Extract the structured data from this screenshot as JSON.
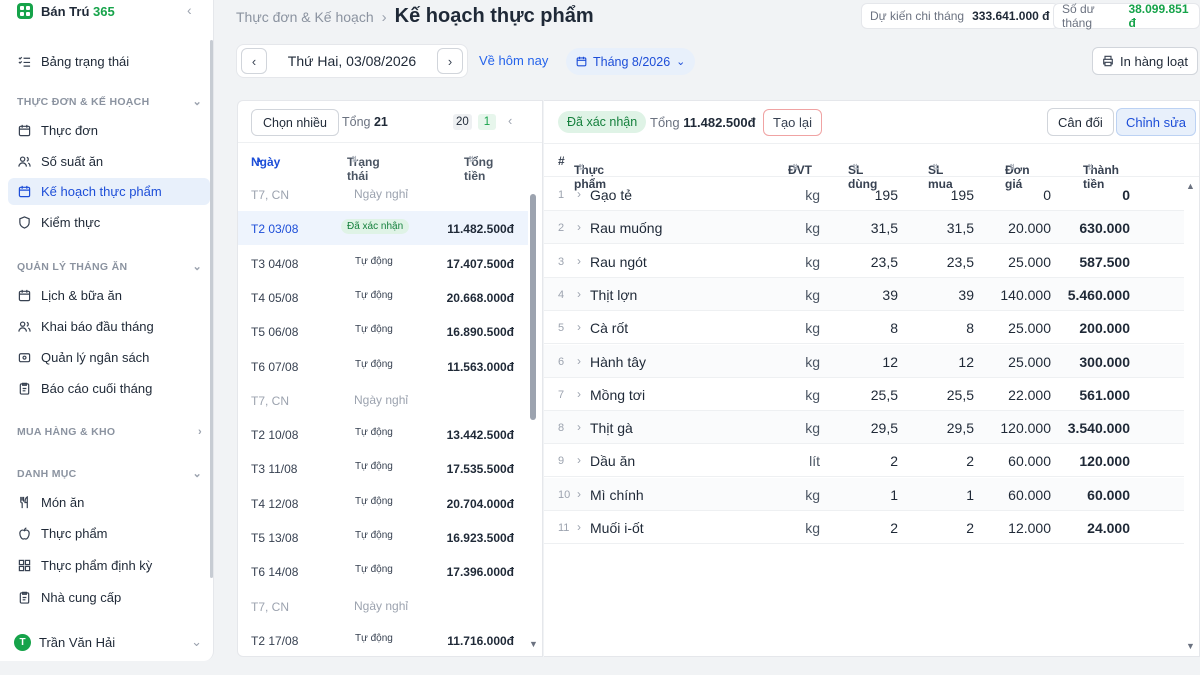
{
  "app": {
    "name_main": "Bán Trú",
    "name_accent": "365",
    "collapse_icon": "chevron-left-icon"
  },
  "sidebar": {
    "top_item": {
      "label": "Bảng trạng thái",
      "icon": "list-check-icon"
    },
    "sections": [
      {
        "title": "THỰC ĐƠN & KẾ HOẠCH",
        "items": [
          {
            "label": "Thực đơn",
            "icon": "calendar-icon"
          },
          {
            "label": "Số suất ăn",
            "icon": "users-icon"
          },
          {
            "label": "Kế hoạch thực phẩm",
            "icon": "calendar-icon",
            "active": true
          },
          {
            "label": "Kiểm thực",
            "icon": "shield-icon"
          }
        ]
      },
      {
        "title": "QUẢN LÝ THÁNG ĂN",
        "items": [
          {
            "label": "Lịch & bữa ăn",
            "icon": "calendar-icon"
          },
          {
            "label": "Khai báo đầu tháng",
            "icon": "users-icon"
          },
          {
            "label": "Quản lý ngân sách",
            "icon": "wallet-icon"
          },
          {
            "label": "Báo cáo cuối tháng",
            "icon": "clipboard-icon"
          }
        ]
      },
      {
        "title": "MUA HÀNG & KHO",
        "items": []
      },
      {
        "title": "DANH MỤC",
        "items": [
          {
            "label": "Món ăn",
            "icon": "utensils-icon"
          },
          {
            "label": "Thực phẩm",
            "icon": "apple-icon"
          },
          {
            "label": "Thực phẩm định kỳ",
            "icon": "grid-icon"
          },
          {
            "label": "Nhà cung cấp",
            "icon": "clipboard-icon"
          }
        ]
      }
    ],
    "user": {
      "initial": "T",
      "name": "Trần Văn Hải"
    }
  },
  "header": {
    "breadcrumb_parent": "Thực đơn & Kế hoạch",
    "breadcrumb_sep": "›",
    "title": "Kế hoạch thực phẩm",
    "stats": [
      {
        "label": "Dự kiến chi tháng",
        "value": "333.641.000 đ",
        "color": "#1f2937"
      },
      {
        "label": "Số dư tháng",
        "value": "38.099.851 đ",
        "color": "#16a34a"
      }
    ]
  },
  "toolbar": {
    "date": "Thứ Hai, 03/08/2026",
    "prev": "‹",
    "next": "›",
    "today_label": "Về hôm nay",
    "month_label": "Tháng 8/2026",
    "print_label": "In hàng loạt"
  },
  "left_panel": {
    "select_many": "Chọn nhiều",
    "total_label": "Tổng",
    "total_value": "21",
    "page_a": "20",
    "page_b": "1",
    "columns": {
      "date": "Ngày",
      "status": "Trạng thái",
      "total": "Tổng tiền"
    },
    "rows": [
      {
        "day": "T7, CN",
        "status": "Ngày nghỉ",
        "amount": "",
        "type": "off"
      },
      {
        "day": "T2   03/08",
        "status": "Đã xác nhận",
        "amount": "11.482.500đ",
        "type": "ok",
        "selected": true
      },
      {
        "day": "T3   04/08",
        "status": "Tự động",
        "amount": "17.407.500đ",
        "type": "auto"
      },
      {
        "day": "T4   05/08",
        "status": "Tự động",
        "amount": "20.668.000đ",
        "type": "auto"
      },
      {
        "day": "T5   06/08",
        "status": "Tự động",
        "amount": "16.890.500đ",
        "type": "auto"
      },
      {
        "day": "T6   07/08",
        "status": "Tự động",
        "amount": "11.563.000đ",
        "type": "auto"
      },
      {
        "day": "T7, CN",
        "status": "Ngày nghỉ",
        "amount": "",
        "type": "off"
      },
      {
        "day": "T2   10/08",
        "status": "Tự động",
        "amount": "13.442.500đ",
        "type": "auto"
      },
      {
        "day": "T3   11/08",
        "status": "Tự động",
        "amount": "17.535.500đ",
        "type": "auto"
      },
      {
        "day": "T4   12/08",
        "status": "Tự động",
        "amount": "20.704.000đ",
        "type": "auto"
      },
      {
        "day": "T5   13/08",
        "status": "Tự động",
        "amount": "16.923.500đ",
        "type": "auto"
      },
      {
        "day": "T6   14/08",
        "status": "Tự động",
        "amount": "17.396.000đ",
        "type": "auto"
      },
      {
        "day": "T7, CN",
        "status": "Ngày nghỉ",
        "amount": "",
        "type": "off"
      },
      {
        "day": "T2   17/08",
        "status": "Tự động",
        "amount": "11.716.000đ",
        "type": "auto"
      }
    ]
  },
  "right_panel": {
    "status_badge": "Đã xác nhận",
    "total_label": "Tổng",
    "total_value": "11.482.500đ",
    "regen_label": "Tạo lại",
    "balance_label": "Cân đối",
    "edit_label": "Chỉnh sửa",
    "columns": {
      "num": "#",
      "food": "Thực phẩm",
      "unit": "ĐVT",
      "used": "SL dùng",
      "buy": "SL mua",
      "price": "Đơn giá",
      "total": "Thành tiền"
    },
    "rows": [
      {
        "n": "1",
        "name": "Gạo tẻ",
        "unit": "kg",
        "used": "195",
        "buy": "195",
        "price": "0",
        "total": "0"
      },
      {
        "n": "2",
        "name": "Rau muống",
        "unit": "kg",
        "used": "31,5",
        "buy": "31,5",
        "price": "20.000",
        "total": "630.000"
      },
      {
        "n": "3",
        "name": "Rau ngót",
        "unit": "kg",
        "used": "23,5",
        "buy": "23,5",
        "price": "25.000",
        "total": "587.500"
      },
      {
        "n": "4",
        "name": "Thịt lợn",
        "unit": "kg",
        "used": "39",
        "buy": "39",
        "price": "140.000",
        "total": "5.460.000"
      },
      {
        "n": "5",
        "name": "Cà rốt",
        "unit": "kg",
        "used": "8",
        "buy": "8",
        "price": "25.000",
        "total": "200.000"
      },
      {
        "n": "6",
        "name": "Hành tây",
        "unit": "kg",
        "used": "12",
        "buy": "12",
        "price": "25.000",
        "total": "300.000"
      },
      {
        "n": "7",
        "name": "Mồng tơi",
        "unit": "kg",
        "used": "25,5",
        "buy": "25,5",
        "price": "22.000",
        "total": "561.000"
      },
      {
        "n": "8",
        "name": "Thịt gà",
        "unit": "kg",
        "used": "29,5",
        "buy": "29,5",
        "price": "120.000",
        "total": "3.540.000"
      },
      {
        "n": "9",
        "name": "Dầu ăn",
        "unit": "lít",
        "used": "2",
        "buy": "2",
        "price": "60.000",
        "total": "120.000"
      },
      {
        "n": "10",
        "name": "Mì chính",
        "unit": "kg",
        "used": "1",
        "buy": "1",
        "price": "60.000",
        "total": "60.000"
      },
      {
        "n": "11",
        "name": "Muối i-ốt",
        "unit": "kg",
        "used": "2",
        "buy": "2",
        "price": "12.000",
        "total": "24.000"
      }
    ]
  }
}
